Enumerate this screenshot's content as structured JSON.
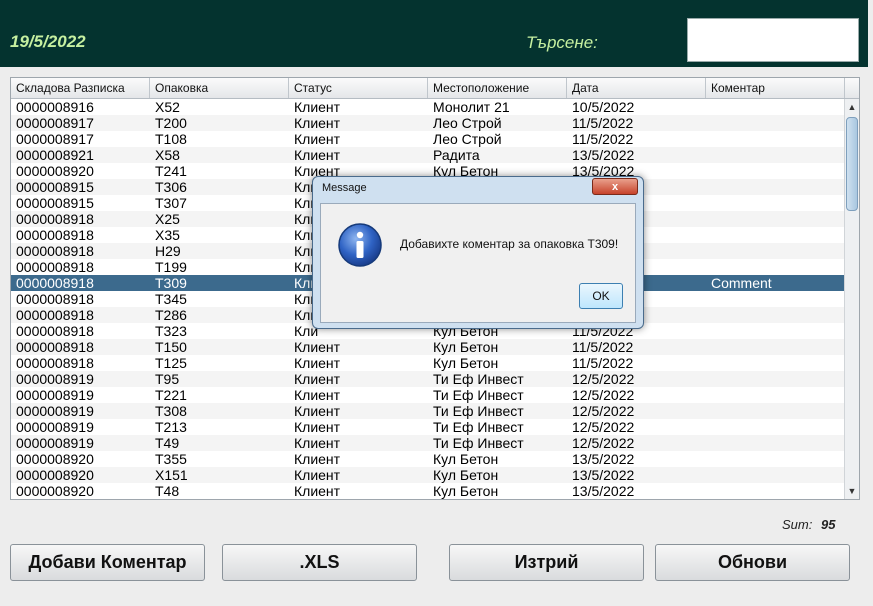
{
  "header": {
    "date": "19/5/2022",
    "search_label": "Търсене:",
    "search_value": ""
  },
  "table": {
    "columns": [
      "Складова Разписка",
      "Опаковка",
      "Статус",
      "Местоположение",
      "Дата",
      "Коментар"
    ],
    "rows": [
      [
        "0000008916",
        "X52",
        "Клиент",
        "Монолит 21",
        "10/5/2022",
        ""
      ],
      [
        "0000008917",
        "T200",
        "Клиент",
        "Лео Строй",
        "11/5/2022",
        ""
      ],
      [
        "0000008917",
        "T108",
        "Клиент",
        "Лео Строй",
        "11/5/2022",
        ""
      ],
      [
        "0000008921",
        "X58",
        "Клиент",
        "Радита",
        "13/5/2022",
        ""
      ],
      [
        "0000008920",
        "T241",
        "Клиент",
        "Кул Бетон",
        "13/5/2022",
        ""
      ],
      [
        "0000008915",
        "T306",
        "Кли",
        "",
        "",
        ""
      ],
      [
        "0000008915",
        "T307",
        "Кли",
        "",
        "",
        ""
      ],
      [
        "0000008918",
        "X25",
        "Кли",
        "",
        "",
        ""
      ],
      [
        "0000008918",
        "X35",
        "Кли",
        "",
        "",
        ""
      ],
      [
        "0000008918",
        "H29",
        "Кли",
        "",
        "",
        ""
      ],
      [
        "0000008918",
        "T199",
        "Кли",
        "",
        "",
        ""
      ],
      [
        "0000008918",
        "T309",
        "Кли",
        "",
        "",
        "Comment"
      ],
      [
        "0000008918",
        "T345",
        "Кли",
        "",
        "",
        ""
      ],
      [
        "0000008918",
        "T286",
        "Кли",
        "",
        "",
        ""
      ],
      [
        "0000008918",
        "T323",
        "Кли",
        "Кул Бетон",
        "11/5/2022",
        ""
      ],
      [
        "0000008918",
        "T150",
        "Клиент",
        "Кул Бетон",
        "11/5/2022",
        ""
      ],
      [
        "0000008918",
        "T125",
        "Клиент",
        "Кул Бетон",
        "11/5/2022",
        ""
      ],
      [
        "0000008919",
        "T95",
        "Клиент",
        "Ти Еф Инвест",
        "12/5/2022",
        ""
      ],
      [
        "0000008919",
        "T221",
        "Клиент",
        "Ти Еф Инвест",
        "12/5/2022",
        ""
      ],
      [
        "0000008919",
        "T308",
        "Клиент",
        "Ти Еф Инвест",
        "12/5/2022",
        ""
      ],
      [
        "0000008919",
        "T213",
        "Клиент",
        "Ти Еф Инвест",
        "12/5/2022",
        ""
      ],
      [
        "0000008919",
        "T49",
        "Клиент",
        "Ти Еф Инвест",
        "12/5/2022",
        ""
      ],
      [
        "0000008920",
        "T355",
        "Клиент",
        "Кул Бетон",
        "13/5/2022",
        ""
      ],
      [
        "0000008920",
        "X151",
        "Клиент",
        "Кул Бетон",
        "13/5/2022",
        ""
      ],
      [
        "0000008920",
        "T48",
        "Клиент",
        "Кул Бетон",
        "13/5/2022",
        ""
      ]
    ],
    "selected_row_index": 11,
    "scroll_up_icon": "arrow-up-icon",
    "scroll_down_icon": "arrow-down-icon"
  },
  "summary": {
    "sum_label": "Sum:",
    "sum_value": "95"
  },
  "buttons": {
    "add_comment": "Добави Коментар",
    "xls": ".XLS",
    "delete": "Изтрий",
    "refresh": "Обнови"
  },
  "dialog": {
    "title": "Message",
    "message": "Добавихте коментар за опаковка T309!",
    "ok_label": "OK",
    "close_label": "x",
    "icon": "info-icon"
  },
  "colors": {
    "header_bg": "#04332f",
    "header_text": "#c6f0a0",
    "selection": "#3c6a8d"
  }
}
